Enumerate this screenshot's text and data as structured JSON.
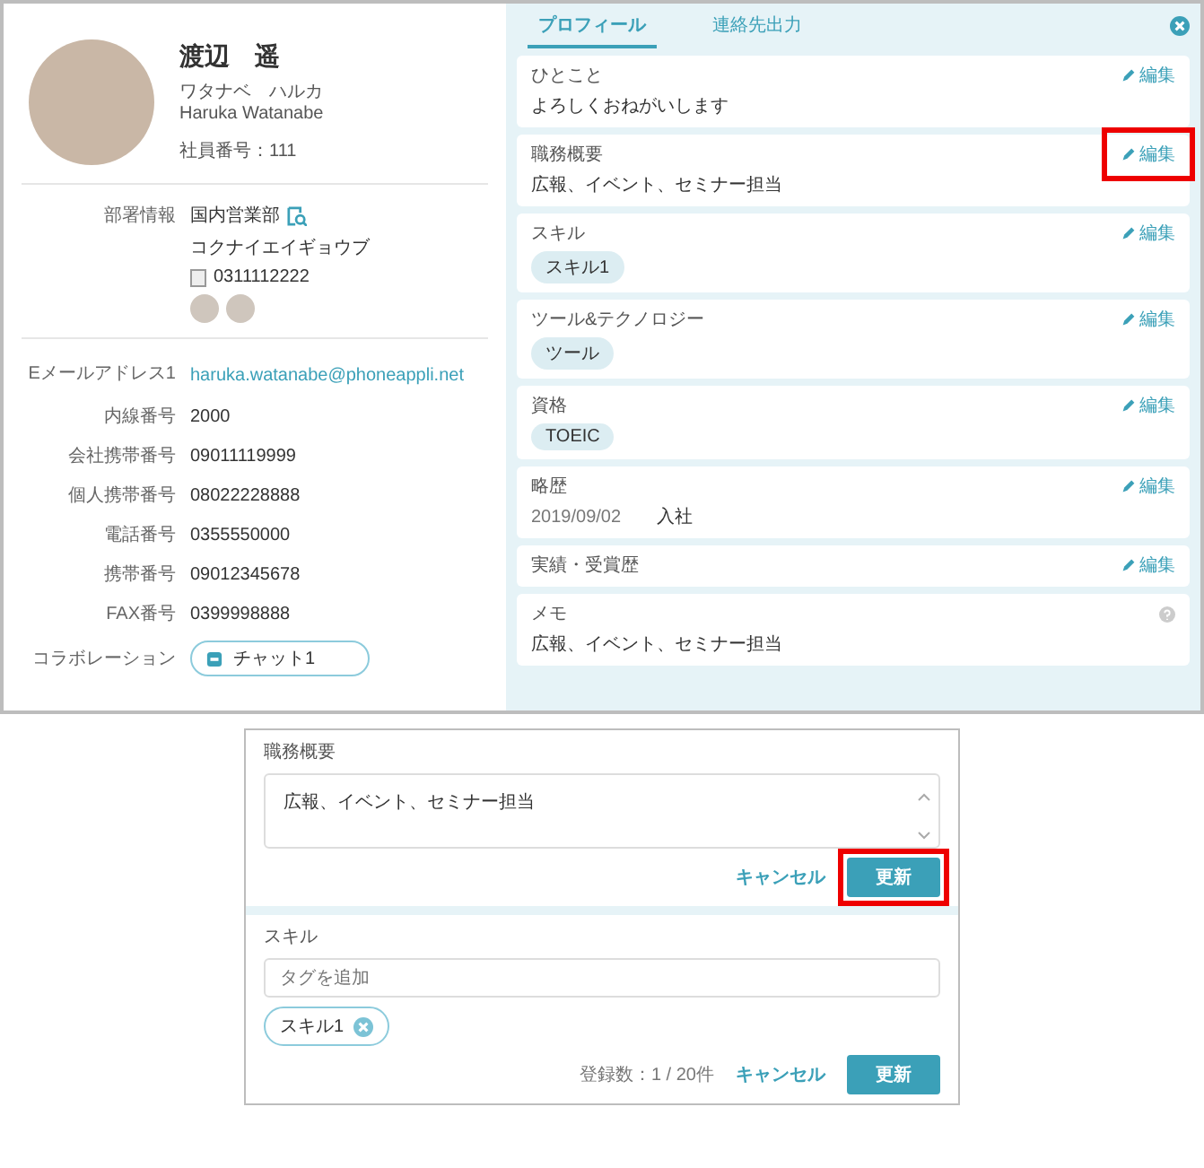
{
  "profile": {
    "name": "渡辺　遥",
    "kana": "ワタナベ　ハルカ",
    "romaji": "Haruka Watanabe",
    "employee_number": "社員番号：111"
  },
  "department": {
    "label": "部署情報",
    "name": "国内営業部",
    "kana": "コクナイエイギョウブ",
    "phone": "0311112222"
  },
  "contacts": [
    {
      "label": "Eメールアドレス1",
      "value": "haruka.watanabe@phoneappli.net",
      "kind": "link"
    },
    {
      "label": "内線番号",
      "value": "2000",
      "kind": "text"
    },
    {
      "label": "会社携帯番号",
      "value": "09011119999",
      "kind": "text"
    },
    {
      "label": "個人携帯番号",
      "value": "08022228888",
      "kind": "text"
    },
    {
      "label": "電話番号",
      "value": "0355550000",
      "kind": "text"
    },
    {
      "label": "携帯番号",
      "value": "09012345678",
      "kind": "text"
    },
    {
      "label": "FAX番号",
      "value": "0399998888",
      "kind": "text"
    },
    {
      "label": "コラボレーション",
      "value": "チャット1",
      "kind": "chat"
    }
  ],
  "tabs": [
    {
      "label": "プロフィール",
      "selected": true
    },
    {
      "label": "連絡先出力",
      "selected": false
    }
  ],
  "sections": [
    {
      "title": "ひとこと",
      "kind": "text",
      "text": "よろしくおねがいします",
      "edit": "編集",
      "highlighted": false
    },
    {
      "title": "職務概要",
      "kind": "text",
      "text": "広報、イベント、セミナー担当",
      "edit": "編集",
      "highlighted": true
    },
    {
      "title": "スキル",
      "kind": "tags",
      "tags": [
        "スキル1"
      ],
      "edit": "編集",
      "highlighted": false
    },
    {
      "title": "ツール&テクノロジー",
      "kind": "tags",
      "tags": [
        "ツール"
      ],
      "edit": "編集",
      "highlighted": false
    },
    {
      "title": "資格",
      "kind": "tags",
      "tags": [
        "TOEIC"
      ],
      "edit": "編集",
      "highlighted": false
    },
    {
      "title": "略歴",
      "kind": "history",
      "entries": [
        {
          "date": "2019/09/02",
          "event": "入社"
        }
      ],
      "edit": "編集",
      "highlighted": false
    },
    {
      "title": "実績・受賞歴",
      "kind": "empty",
      "edit": "編集",
      "highlighted": false
    },
    {
      "title": "メモ",
      "kind": "memo",
      "text": "広報、イベント、セミナー担当"
    }
  ],
  "editor": [
    {
      "title": "職務概要",
      "kind": "textarea",
      "value": "広報、イベント、セミナー担当",
      "cancel": "キャンセル",
      "submit": "更新",
      "highlighted": true
    },
    {
      "title": "スキル",
      "kind": "tags",
      "placeholder": "タグを追加",
      "tags": [
        "スキル1"
      ],
      "count": "登録数：1 / 20件",
      "cancel": "キャンセル",
      "submit": "更新",
      "highlighted": false
    }
  ]
}
